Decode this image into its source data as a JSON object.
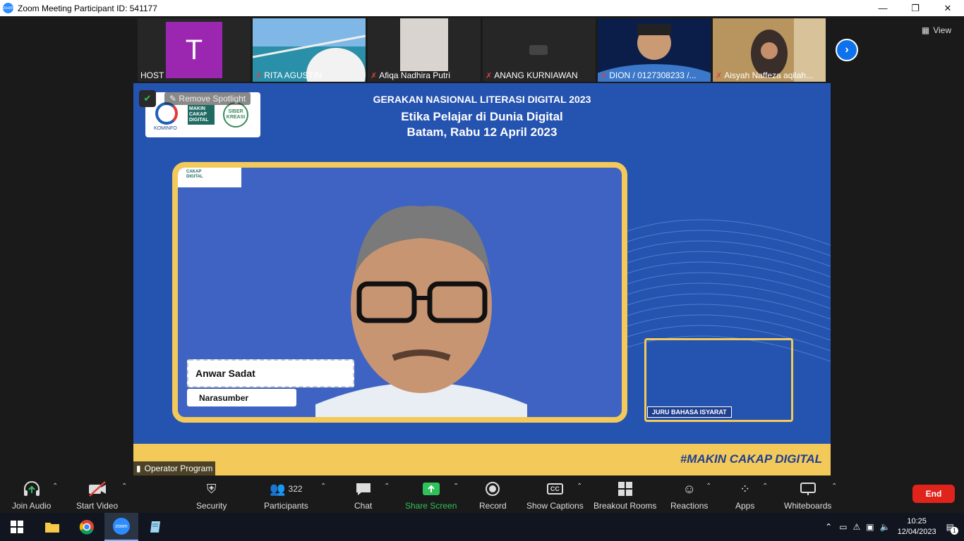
{
  "window": {
    "title": "Zoom Meeting Participant ID: 541177",
    "zoom_icon_text": "zoom",
    "minimize": "—",
    "restore": "❐",
    "close": "✕"
  },
  "gallery": {
    "view_label": "View",
    "next_arrow": "›",
    "host_initial": "T",
    "participants": [
      {
        "name": "HOST",
        "muted": false
      },
      {
        "name": "RITA AGUSTIN",
        "muted": true
      },
      {
        "name": "Afiqa Nadhira Putri",
        "muted": true
      },
      {
        "name": "ANANG KURNIAWAN",
        "muted": true
      },
      {
        "name": "DION / 0127308233 /...",
        "muted": true
      },
      {
        "name": "Aisyah Naffeza aqilah...",
        "muted": true
      }
    ],
    "mute_glyph": "✗"
  },
  "stage": {
    "remove_spotlight": "Remove Spotlight",
    "kominfo_label": "KOMINFO",
    "makin_cakap_logo": [
      "MAKIN",
      "CAKAP",
      "DIGITAL"
    ],
    "siberkreasi_logo": [
      "SIBER",
      "KREASI"
    ],
    "frame_logo": [
      "CAKAP",
      "DIGITAL"
    ],
    "slide_header": "GERAKAN NASIONAL LITERASI DIGITAL 2023",
    "slide_title": "Etika Pelajar di Dunia Digital",
    "slide_subtitle": "Batam, Rabu 12 April 2023",
    "speaker_name": "Anwar Sadat",
    "speaker_role": "Narasumber",
    "interpreter_label": "JURU BAHASA ISYARAT",
    "hashtag": "#MAKIN CAKAP DIGITAL",
    "operator_label": "Operator Program"
  },
  "toolbar": {
    "join_audio": "Join Audio",
    "start_video": "Start Video",
    "security": "Security",
    "participants": "Participants",
    "participant_count": "322",
    "chat": "Chat",
    "share_screen": "Share Screen",
    "record": "Record",
    "show_captions": "Show Captions",
    "cc": "CC",
    "breakout_rooms": "Breakout Rooms",
    "reactions": "Reactions",
    "apps": "Apps",
    "whiteboards": "Whiteboards",
    "end": "End"
  },
  "taskbar": {
    "time": "10:25",
    "date": "12/04/2023",
    "notification_count": "1",
    "zoom_app_text": "zoom"
  },
  "colors": {
    "zoom_blue": "#0E72ED",
    "stage_blue": "#2553b0",
    "gold": "#f3c95a",
    "end_red": "#e0241b",
    "share_green": "#2fc25b",
    "mute_red": "#e0413b"
  }
}
